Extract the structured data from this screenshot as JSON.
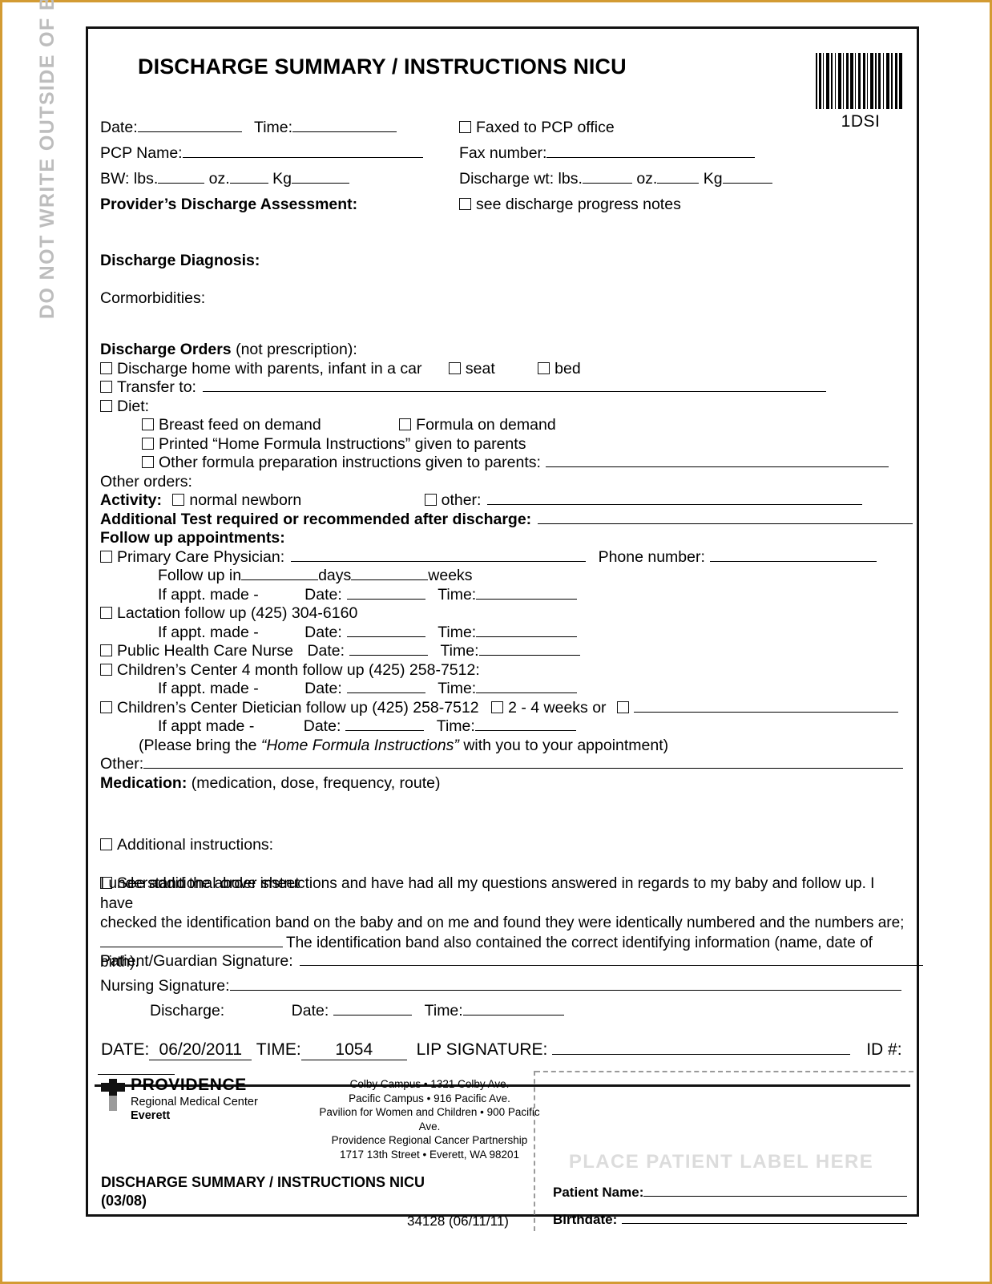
{
  "side_warning": "DO NOT WRITE OUTSIDE OF BORDER AREA",
  "header": {
    "title": "DISCHARGE SUMMARY / INSTRUCTIONS NICU",
    "barcode_label": "1DSI",
    "date_label": "Date:",
    "time_label": "Time:",
    "pcp_name_label": "PCP Name:",
    "bw_label": "BW: lbs.",
    "bw_oz": "oz.",
    "bw_kg": "Kg",
    "provider_assessment_label": "Provider’s Discharge Assessment:",
    "faxed_label": "Faxed to PCP office",
    "fax_number_label": "Fax number:",
    "discharge_wt_label": "Discharge wt: lbs.",
    "dw_oz": "oz.",
    "dw_kg": "Kg",
    "see_notes_label": "see discharge progress notes"
  },
  "diagnosis": {
    "discharge_diagnosis_label": "Discharge Diagnosis:",
    "comorbidities_label": "Cormorbidities:"
  },
  "orders": {
    "heading_bold": "Discharge Orders",
    "heading_rest": " (not prescription):",
    "home_with_parents": "Discharge home with parents, infant in a car",
    "seat": "seat",
    "bed": "bed",
    "transfer_to": "Transfer to:",
    "diet": "Diet:",
    "breast_feed": "Breast feed on demand",
    "formula_on_demand": "Formula on demand",
    "printed_home_formula": "Printed “Home Formula Instructions” given to parents",
    "other_formula": "Other formula preparation instructions given to parents:",
    "other_orders_label": "Other orders:",
    "activity_label": "Activity:",
    "normal_newborn": "normal newborn",
    "other": "other:",
    "additional_test": "Additional Test required or recommended after discharge:"
  },
  "followup": {
    "heading": "Follow up appointments:",
    "pcp": "Primary Care Physician:",
    "phone_number": "Phone number:",
    "follow_up_in": "Follow up in",
    "days": "days",
    "weeks": "weeks",
    "if_appt_made": "If appt. made -",
    "date_label": "Date:",
    "time_label": "Time:",
    "lactation": "Lactation follow up (425) 304-6160",
    "public_health_nurse": "Public Health Care Nurse",
    "childrens_center_4mo": "Children’s Center 4 month follow up (425) 258-7512:",
    "childrens_center_diet": "Children’s Center Dietician follow up (425) 258-7512",
    "two_four_weeks": "2 - 4 weeks or",
    "if_appt_made_2": "If appt made -",
    "please_bring_pre": "(Please bring the ",
    "please_bring_italic": "“Home Formula Instructions”",
    "please_bring_post": " with you to your appointment)",
    "other_label": "Other:"
  },
  "medication": {
    "label_bold": "Medication:",
    "label_rest": " (medication, dose, frequency, route)"
  },
  "instructions": {
    "additional_instructions": "Additional instructions:",
    "see_additional_order_sheet": "See additional order sheet"
  },
  "consent": {
    "line1": "I understand the above instructions and have had all my questions answered in regards to my baby and follow up. I have",
    "line2": "checked the identification band on the baby and on me and found they were identically numbered and the numbers are;",
    "line3": "The identification band also contained the correct identifying information (name, date of birth)."
  },
  "signatures": {
    "patient_guardian": "Patient/Guardian Signature:",
    "nursing": "Nursing Signature:",
    "discharge_label": "Discharge:",
    "date_label": "Date:",
    "time_label": "Time:"
  },
  "dateband": {
    "date_label": "DATE:",
    "date_value": "06/20/2011",
    "time_label": "TIME:",
    "time_value": "1054",
    "lip_signature_label": "LIP SIGNATURE:",
    "id_label": "ID #:"
  },
  "footer": {
    "org_name": "PROVIDENCE",
    "org_sub": "Regional Medical Center",
    "org_city": "Everett",
    "address_lines": [
      "Colby Campus  •   1321 Colby Ave.",
      "Pacific Campus  •  916 Pacific Ave.",
      "Pavilion for Women and Children  •  900 Pacific Ave.",
      "Providence Regional Cancer Partnership",
      "1717 13th Street  •  Everett, WA  98201"
    ],
    "form_title": "DISCHARGE SUMMARY / INSTRUCTIONS NICU",
    "form_revision": "(03/08)",
    "form_number": "34128 (06/11/11)",
    "place_label": "PLACE PATIENT LABEL HERE",
    "patient_name_label": "Patient Name:",
    "birthdate_label": "Birthdate:"
  },
  "colors": {
    "page_border": "#d39b33",
    "form_border": "#111111",
    "watermark_gray": "#dcdcdc",
    "side_warning_gray": "#bdbdbd"
  }
}
